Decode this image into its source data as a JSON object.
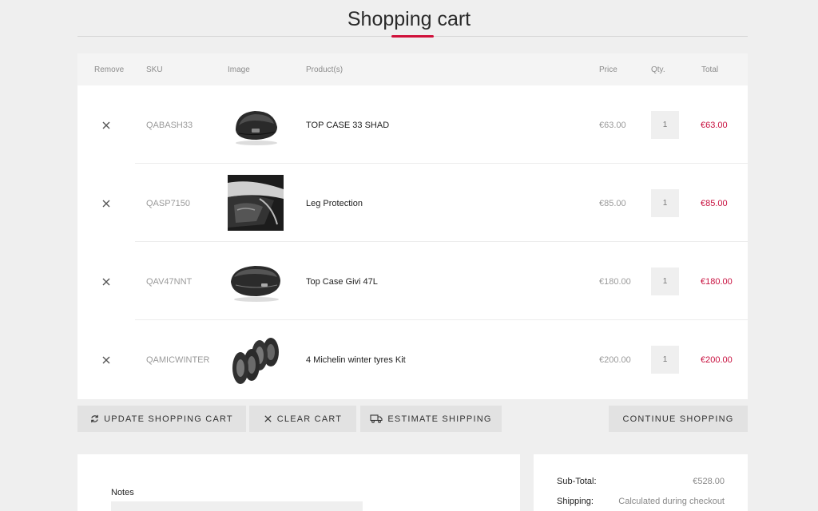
{
  "page": {
    "title": "Shopping cart"
  },
  "table": {
    "headers": {
      "remove": "Remove",
      "sku": "SKU",
      "image": "Image",
      "product": "Product(s)",
      "price": "Price",
      "qty": "Qty.",
      "total": "Total"
    },
    "rows": [
      {
        "sku": "QABASH33",
        "name": "TOP CASE 33 SHAD",
        "price": "€63.00",
        "qty": "1",
        "total": "€63.00",
        "image_icon": "top-case-shad-image"
      },
      {
        "sku": "QASP7150",
        "name": "Leg Protection",
        "price": "€85.00",
        "qty": "1",
        "total": "€85.00",
        "image_icon": "leg-protection-image"
      },
      {
        "sku": "QAV47NNT",
        "name": "Top Case Givi 47L",
        "price": "€180.00",
        "qty": "1",
        "total": "€180.00",
        "image_icon": "top-case-givi-image"
      },
      {
        "sku": "QAMICWINTER",
        "name": "4 Michelin winter tyres Kit",
        "price": "€200.00",
        "qty": "1",
        "total": "€200.00",
        "image_icon": "winter-tyres-image"
      }
    ]
  },
  "actions": {
    "update": "UPDATE SHOPPING CART",
    "clear": "CLEAR CART",
    "estimate": "ESTIMATE SHIPPING",
    "continue": "CONTINUE SHOPPING"
  },
  "notes": {
    "label": "Notes"
  },
  "summary": {
    "subtotal_label": "Sub-Total:",
    "subtotal_value": "€528.00",
    "shipping_label": "Shipping:",
    "shipping_value": "Calculated during checkout"
  },
  "colors": {
    "accent": "#d0103a",
    "total_text": "#c8103f",
    "background": "#efefef"
  }
}
